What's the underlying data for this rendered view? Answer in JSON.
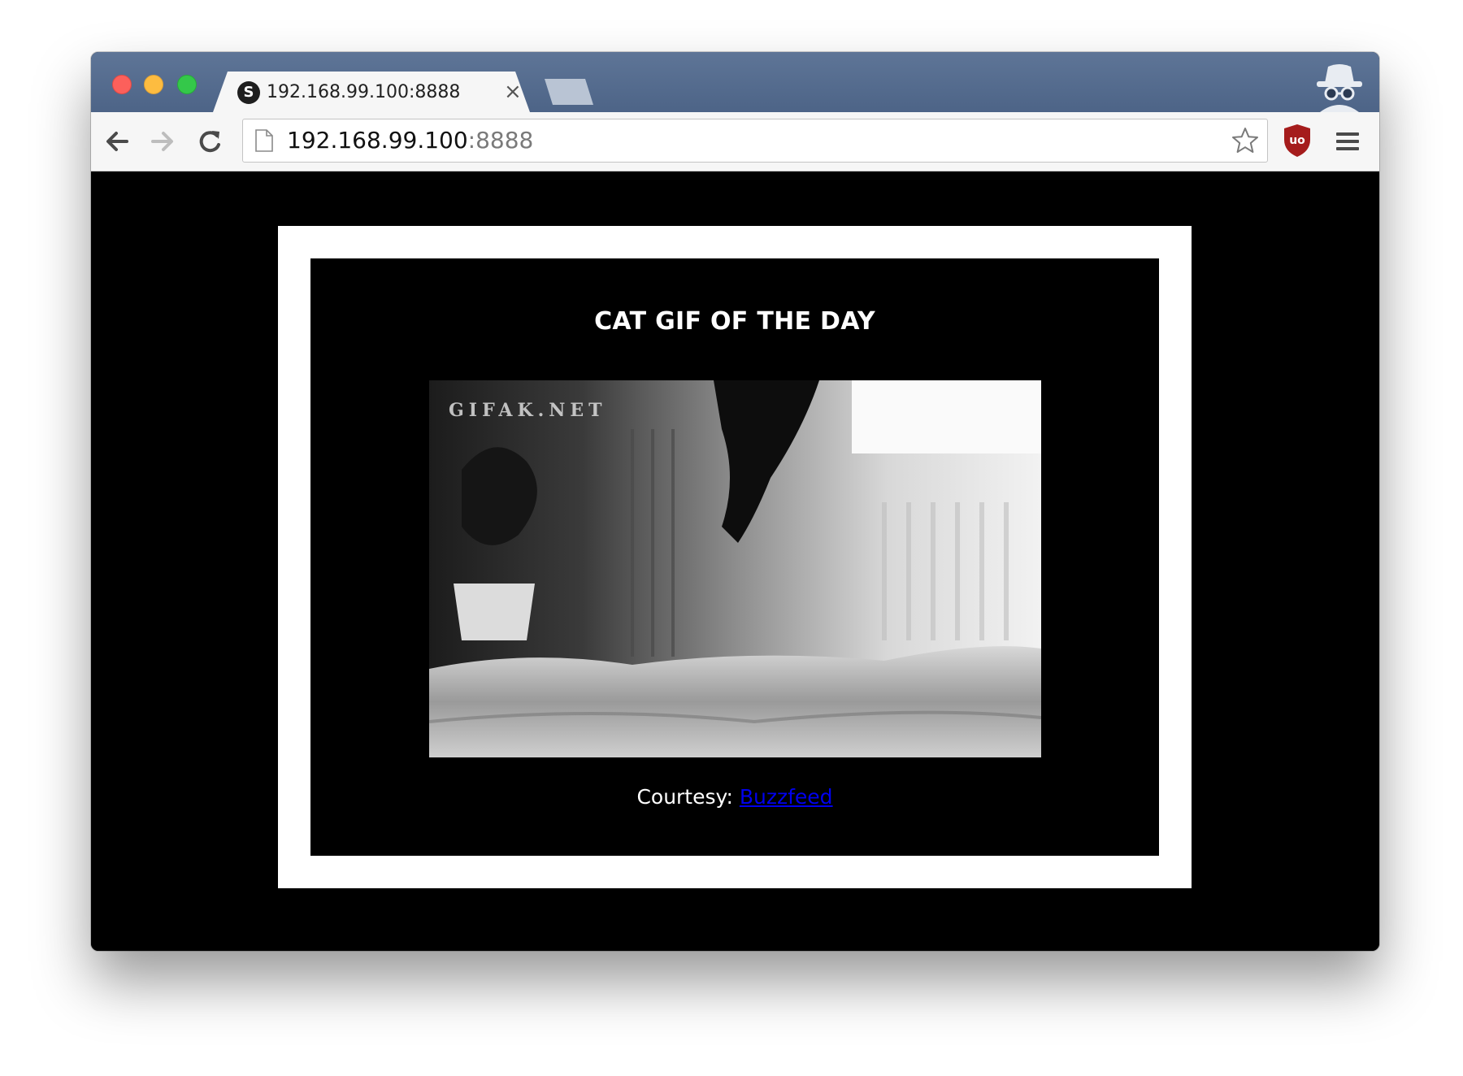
{
  "browser": {
    "tab": {
      "favicon_letter": "S",
      "title": "192.168.99.100:8888",
      "close_glyph": "×"
    },
    "address_bar": {
      "host": "192.168.99.100",
      "port": ":8888"
    },
    "icons": {
      "back": "back-arrow-icon",
      "forward": "forward-arrow-icon",
      "reload": "reload-icon",
      "page": "page-icon",
      "bookmark": "star-icon",
      "extension": "ublock-origin-icon",
      "menu": "hamburger-menu-icon",
      "incognito": "incognito-icon"
    },
    "colors": {
      "titlebar": "#4d6487",
      "close": "#fc605b",
      "minimize": "#fdbc40",
      "maximize": "#34c84a",
      "ublock": "#a51c1c"
    }
  },
  "page": {
    "heading": "CAT GIF OF THE DAY",
    "gif": {
      "watermark": "GIFAK.NET"
    },
    "courtesy": {
      "label": "Courtesy:",
      "link_text": "Buzzfeed"
    },
    "colors": {
      "background": "#000000",
      "frame": "#ffffff",
      "link": "#0000ee"
    }
  }
}
